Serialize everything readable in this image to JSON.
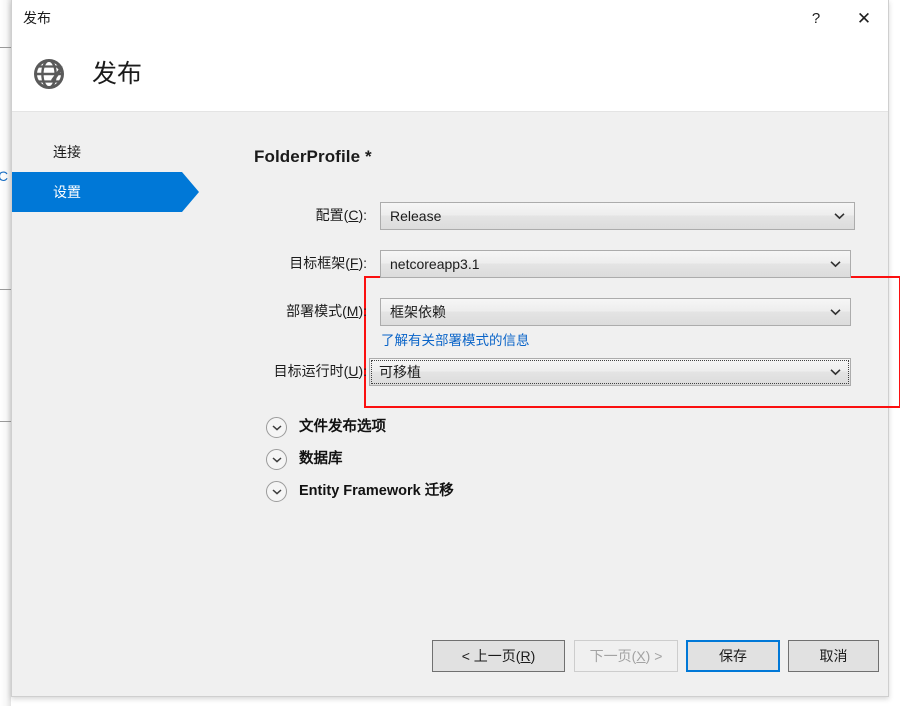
{
  "background": {
    "fragment_letter": "C"
  },
  "titlebar": {
    "title": "发布",
    "help_label": "?",
    "close_label": "✕"
  },
  "header": {
    "title": "发布",
    "icon": "globe-publish-icon"
  },
  "nav": {
    "items": [
      {
        "label": "连接",
        "selected": false
      },
      {
        "label": "设置",
        "selected": true
      }
    ]
  },
  "content": {
    "profile_title": "FolderProfile *",
    "rows": [
      {
        "label_prefix": "配置(",
        "mnemonic": "C",
        "label_suffix": "):",
        "value": "Release"
      },
      {
        "label_prefix": "目标框架(",
        "mnemonic": "F",
        "label_suffix": "):",
        "value": "netcoreapp3.1"
      },
      {
        "label_prefix": "部署模式(",
        "mnemonic": "M",
        "label_suffix": "):",
        "value": "框架依赖"
      },
      {
        "label_prefix": "目标运行时(",
        "mnemonic": "U",
        "label_suffix": "):",
        "value": "可移植"
      }
    ],
    "deploy_link": "了解有关部署模式的信息",
    "sections": [
      {
        "label": "文件发布选项",
        "icon": "chevron-down-icon"
      },
      {
        "label": "数据库",
        "icon": "chevron-down-icon"
      },
      {
        "label": "Entity Framework 迁移",
        "icon": "chevron-down-icon"
      }
    ]
  },
  "footer": {
    "prev": {
      "prefix": "< 上一页(",
      "mnemonic": "R",
      "suffix": ")"
    },
    "next": {
      "prefix": "下一页(",
      "mnemonic": "X",
      "suffix": ") >"
    },
    "save": "保存",
    "cancel": "取消"
  },
  "colors": {
    "accent": "#0078d7",
    "annotation": "#fb0f0f",
    "link": "#0a64c8",
    "dialog_bg": "#f0f0f0"
  }
}
